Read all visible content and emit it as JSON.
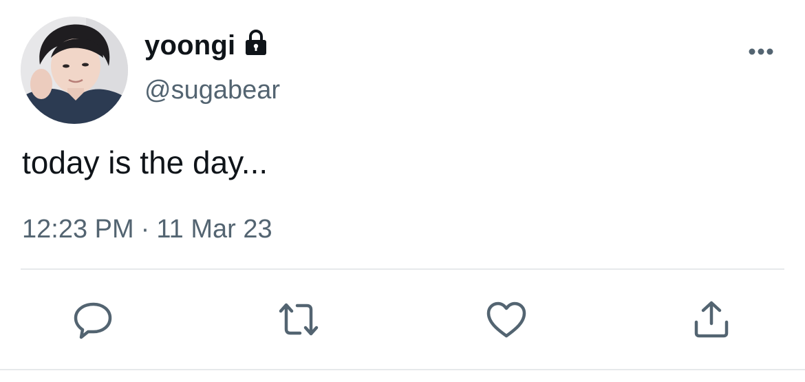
{
  "tweet": {
    "display_name": "yoongi",
    "handle": "@sugabear",
    "text": "today is the day...",
    "time": "12:23 PM",
    "separator": "·",
    "date": "11 Mar 23",
    "protected_icon": "lock-icon",
    "menu_icon": "more-horizontal-icon"
  },
  "actions": [
    {
      "name": "reply",
      "icon": "reply-icon"
    },
    {
      "name": "retweet",
      "icon": "retweet-icon"
    },
    {
      "name": "like",
      "icon": "heart-icon"
    },
    {
      "name": "share",
      "icon": "share-icon"
    }
  ],
  "colors": {
    "text_primary": "#0f1419",
    "text_secondary": "#536471",
    "divider": "#e6e9eb"
  }
}
